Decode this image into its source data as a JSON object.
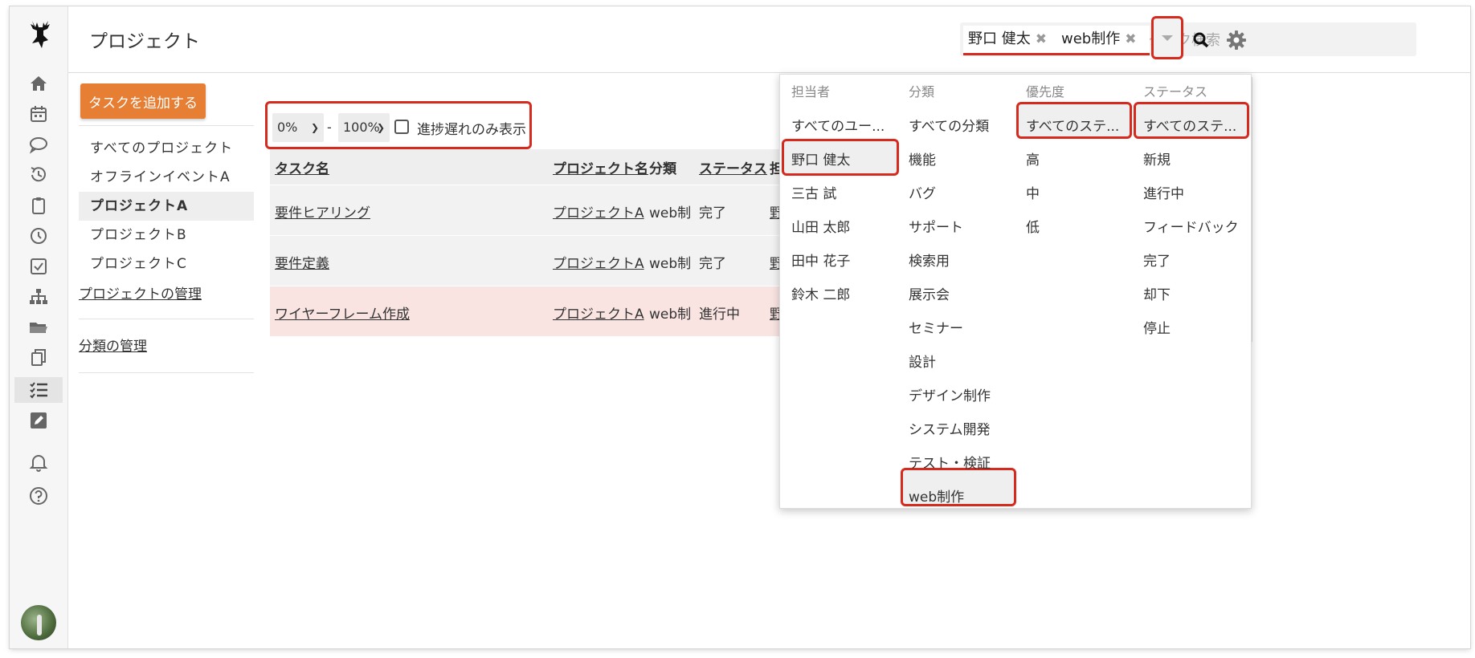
{
  "header": {
    "title": "プロジェクト",
    "search": {
      "chips": [
        {
          "label": "野口 健太"
        },
        {
          "label": "web制作"
        }
      ],
      "placeholder": "タスク検索"
    }
  },
  "icons": {
    "logo": "deer-icon",
    "nav": [
      "home-icon",
      "calendar-icon",
      "chat-icon",
      "history-icon",
      "clipboard-icon",
      "clock-icon",
      "checkbox-icon",
      "sitemap-icon",
      "folder-icon",
      "copy-icon",
      "task-list-icon",
      "edit-icon",
      "bell-icon",
      "help-icon"
    ]
  },
  "actions": {
    "add_task": "タスクを追加する"
  },
  "projects": {
    "items": [
      "すべてのプロジェクト",
      "オフラインイベントA",
      "プロジェクトA",
      "プロジェクトB",
      "プロジェクトC"
    ],
    "active": "プロジェクトA",
    "manage_projects": "プロジェクトの管理",
    "manage_categories": "分類の管理"
  },
  "filter": {
    "from": "0%",
    "separator": "-",
    "to": "100%",
    "delayed_only_label": "進捗遅れのみ表示"
  },
  "table": {
    "headers": [
      "タスク名",
      "プロジェクト名",
      "分類",
      "ステータス",
      "担"
    ],
    "rows": [
      {
        "task": "要件ヒアリング",
        "project": "プロジェクトA",
        "category": "web制",
        "status": "完了",
        "assignee": "野"
      },
      {
        "task": "要件定義",
        "project": "プロジェクトA",
        "category": "web制",
        "status": "完了",
        "assignee": "野"
      },
      {
        "task": "ワイヤーフレーム作成",
        "project": "プロジェクトA",
        "category": "web制",
        "status": "進行中",
        "assignee": "野"
      }
    ]
  },
  "dropdown": {
    "assignee": {
      "header": "担当者",
      "options": [
        "すべてのユー...",
        "野口 健太",
        "三古 試",
        "山田 太郎",
        "田中 花子",
        "鈴木 二郎"
      ],
      "selected": "野口 健太"
    },
    "category": {
      "header": "分類",
      "options": [
        "すべての分類",
        "機能",
        "バグ",
        "サポート",
        "検索用",
        "展示会",
        "セミナー",
        "設計",
        "デザイン制作",
        "システム開発",
        "テスト・検証",
        "web制作"
      ],
      "selected": "web制作"
    },
    "priority": {
      "header": "優先度",
      "options": [
        "すべてのステ...",
        "高",
        "中",
        "低"
      ],
      "selected": "すべてのステ..."
    },
    "status": {
      "header": "ステータス",
      "options": [
        "すべてのステ...",
        "新規",
        "進行中",
        "フィードバック",
        "完了",
        "却下",
        "停止"
      ],
      "selected": "すべてのステ..."
    }
  },
  "colors": {
    "accent": "#e67e34",
    "highlight": "#d62a1e",
    "late_row": "#f9e4e1"
  }
}
